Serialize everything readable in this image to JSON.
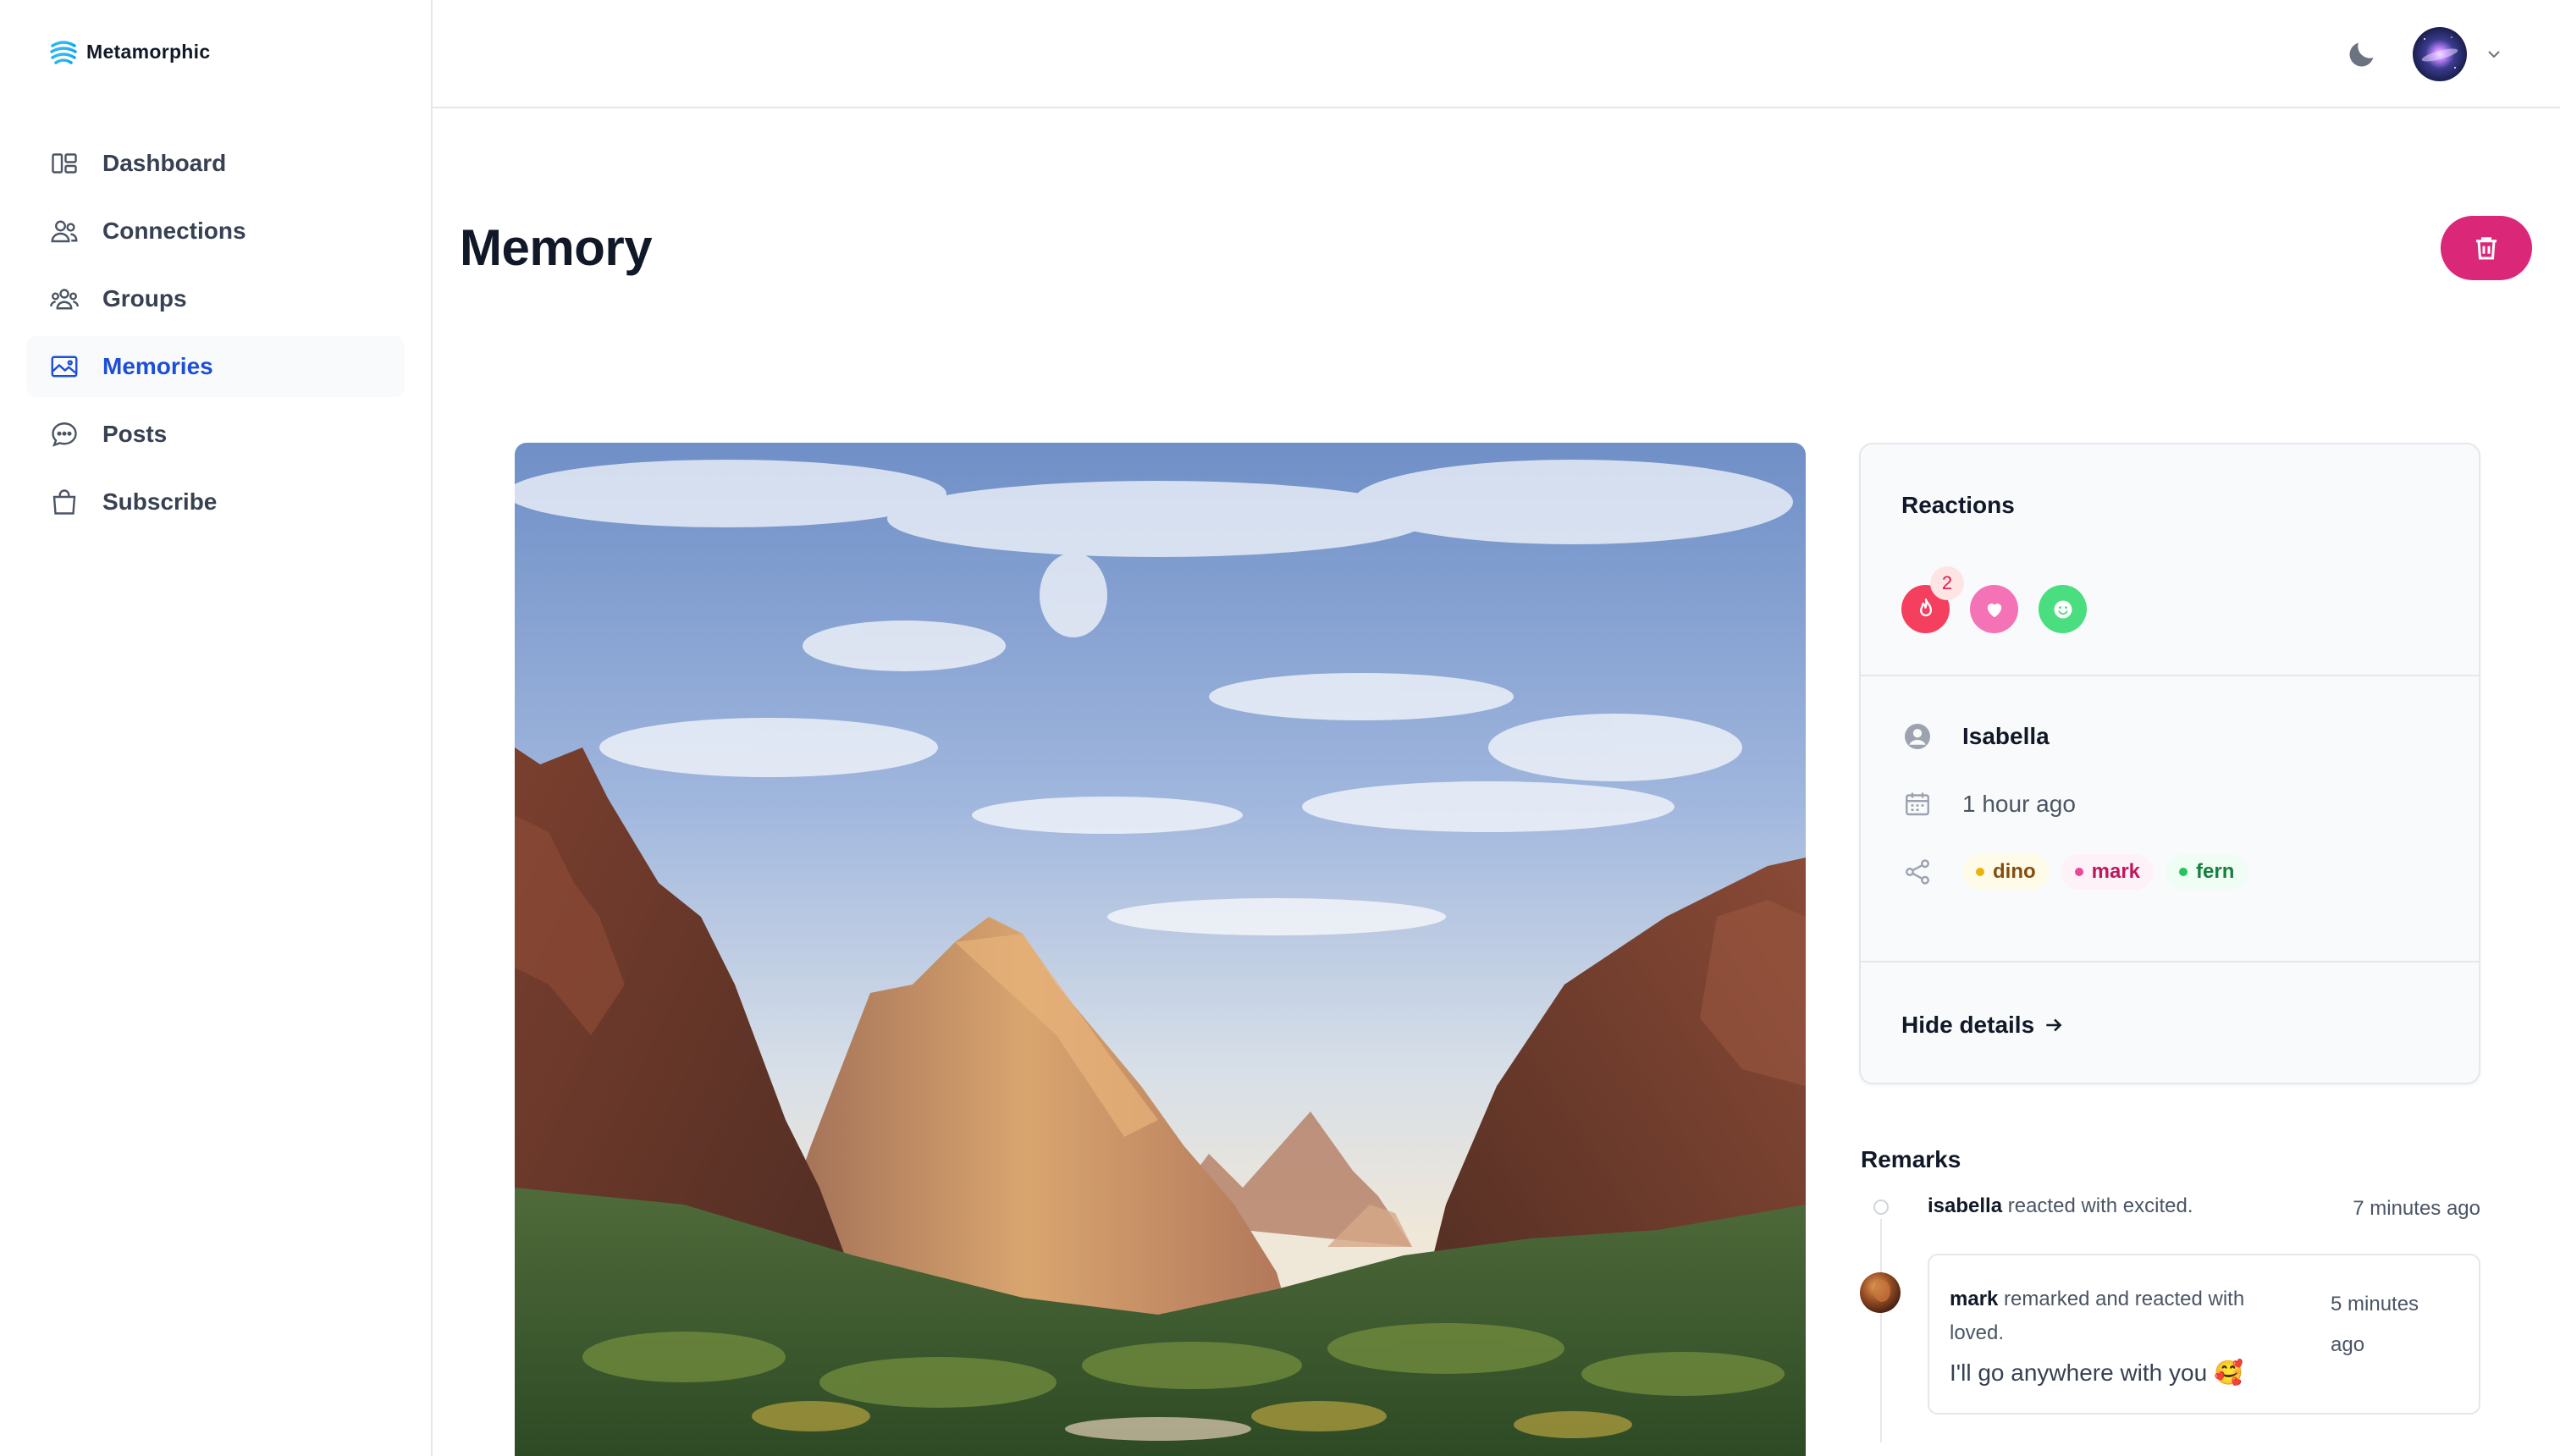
{
  "app": {
    "name": "Metamorphic"
  },
  "sidebar": {
    "items": [
      {
        "label": "Dashboard",
        "icon": "dashboard-icon",
        "active": false
      },
      {
        "label": "Connections",
        "icon": "users-icon",
        "active": false
      },
      {
        "label": "Groups",
        "icon": "group-icon",
        "active": false
      },
      {
        "label": "Memories",
        "icon": "image-icon",
        "active": true
      },
      {
        "label": "Posts",
        "icon": "chat-bubble-icon",
        "active": false
      },
      {
        "label": "Subscribe",
        "icon": "shopping-bag-icon",
        "active": false
      }
    ]
  },
  "page": {
    "title": "Memory"
  },
  "details": {
    "reactions_title": "Reactions",
    "reactions": [
      {
        "type": "fire",
        "count": "2",
        "color": "#f43f5e"
      },
      {
        "type": "heart",
        "color": "#f472b6"
      },
      {
        "type": "smile",
        "color": "#4ade80"
      }
    ],
    "author": "Isabella",
    "time": "1 hour ago",
    "tags": [
      "dino",
      "mark",
      "fern"
    ],
    "hide_label": "Hide details"
  },
  "remarks": {
    "title": "Remarks",
    "items": [
      {
        "user": "isabella",
        "action": "reacted with excited.",
        "time": "7 minutes ago"
      },
      {
        "user": "mark",
        "action": "remarked and reacted with loved.",
        "time": "5 minutes ago",
        "text": "I'll go anywhere with you 🥰"
      }
    ]
  },
  "colors": {
    "accent": "#1d4ed8",
    "delete": "#db2777"
  }
}
